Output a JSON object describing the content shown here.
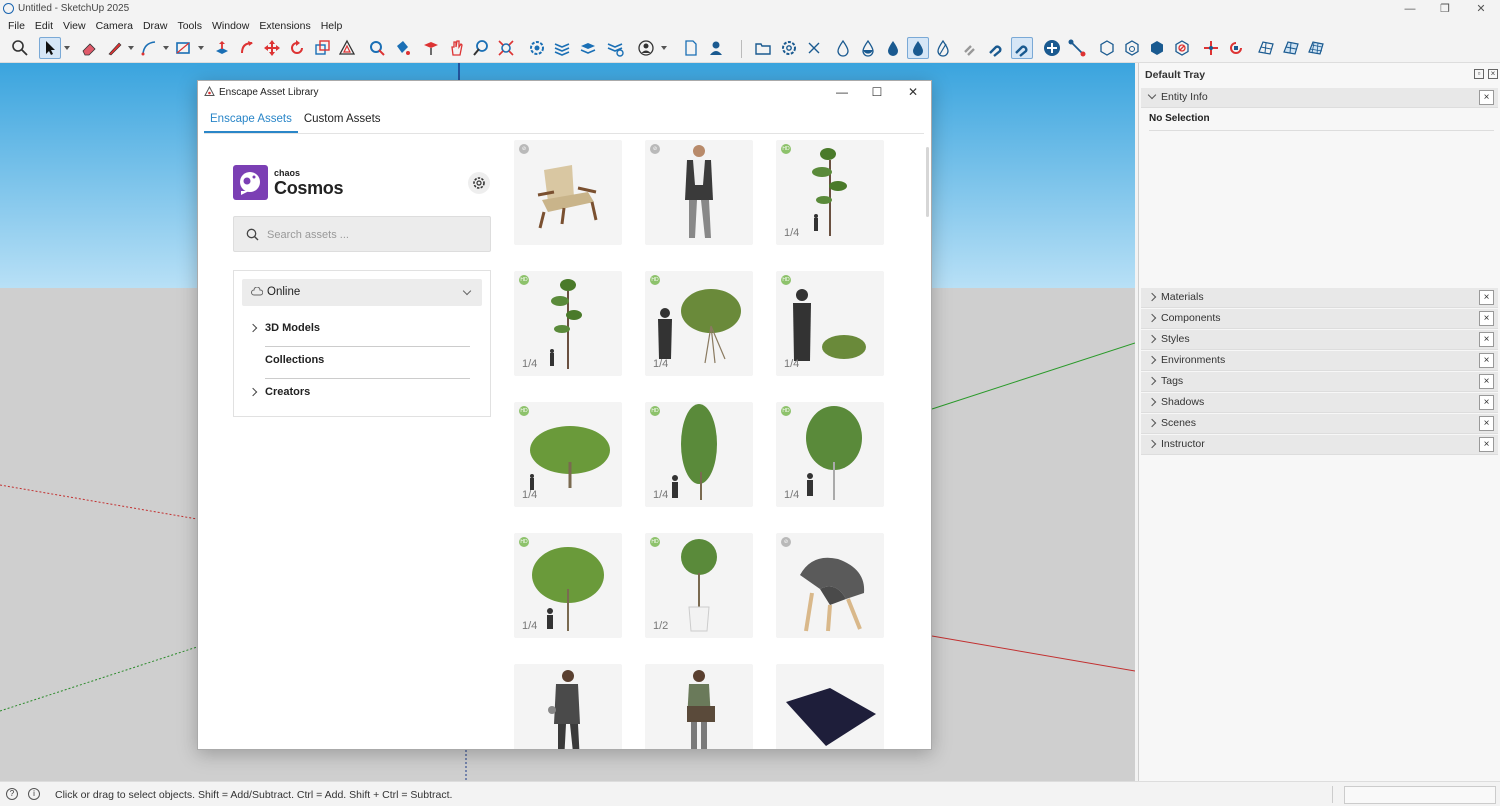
{
  "window": {
    "title": "Untitled - SketchUp 2025"
  },
  "menu": [
    "File",
    "Edit",
    "View",
    "Camera",
    "Draw",
    "Tools",
    "Window",
    "Extensions",
    "Help"
  ],
  "tray": {
    "title": "Default Tray",
    "entity_info": {
      "label": "Entity Info",
      "value": "No Selection"
    },
    "panels": [
      "Materials",
      "Components",
      "Styles",
      "Environments",
      "Tags",
      "Shadows",
      "Scenes",
      "Instructor"
    ]
  },
  "status": {
    "text": "Click or drag to select objects. Shift = Add/Subtract. Ctrl = Add. Shift + Ctrl = Subtract."
  },
  "dialog": {
    "title": "Enscape Asset Library",
    "tabs": [
      "Enscape Assets",
      "Custom Assets"
    ],
    "active_tab": "Enscape Assets",
    "logo": {
      "small": "chaos",
      "big": "Cosmos",
      "color": "#7b3fb4"
    },
    "search": {
      "placeholder": "Search assets ..."
    },
    "source_select": {
      "value": "Online"
    },
    "nav": [
      "3D Models",
      "Collections",
      "Creators"
    ],
    "assets": [
      {
        "kind": "chair-wood",
        "badge": "gray",
        "count": ""
      },
      {
        "kind": "man-standing",
        "badge": "gray",
        "count": ""
      },
      {
        "kind": "tall-tree",
        "badge": "hd",
        "count": "1/4"
      },
      {
        "kind": "pine-tree",
        "badge": "hd",
        "count": "1/4"
      },
      {
        "kind": "shrub-bush",
        "badge": "hd",
        "count": "1/4"
      },
      {
        "kind": "low-shrub",
        "badge": "hd",
        "count": "1/4"
      },
      {
        "kind": "wide-tree",
        "badge": "hd",
        "count": "1/4"
      },
      {
        "kind": "column-tree",
        "badge": "hd",
        "count": "1/4"
      },
      {
        "kind": "round-tree",
        "badge": "hd",
        "count": "1/4"
      },
      {
        "kind": "spread-tree",
        "badge": "hd",
        "count": "1/4"
      },
      {
        "kind": "topiary",
        "badge": "hd",
        "count": "1/2"
      },
      {
        "kind": "shell-chair",
        "badge": "gray",
        "count": ""
      },
      {
        "kind": "woman-phone",
        "badge": "",
        "count": ""
      },
      {
        "kind": "woman-bag",
        "badge": "",
        "count": ""
      },
      {
        "kind": "rug",
        "badge": "",
        "count": ""
      }
    ]
  },
  "colors": {
    "accent": "#2a86c8",
    "sky": "#3aa4de",
    "ground": "#cfcfcf",
    "hd_badge": "#8dc26b"
  }
}
